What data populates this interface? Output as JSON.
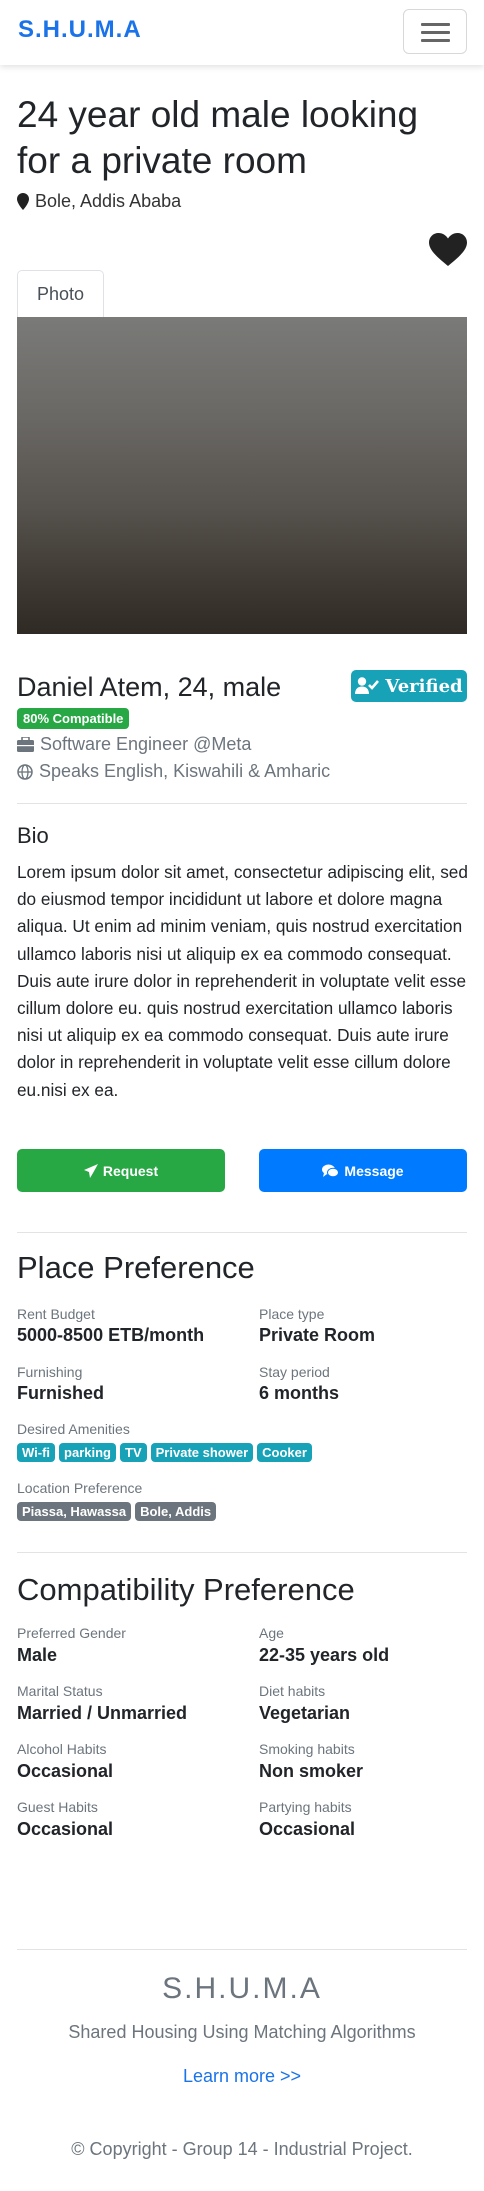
{
  "navbar": {
    "brand": "S.H.U.M.A",
    "menu_icon": "hamburger-menu-icon"
  },
  "listing": {
    "title": "24 year old male looking for a private room",
    "location": "Bole, Addis Ababa",
    "favorite_icon": "heart-icon"
  },
  "tabs": [
    {
      "label": "Photo",
      "active": true
    }
  ],
  "profile": {
    "name": "Daniel Atem, 24, male",
    "verified_label": "Verified",
    "compatibility": "80% Compatible",
    "job": "Software Engineer @Meta",
    "languages": "Speaks English, Kiswahili & Amharic"
  },
  "bio": {
    "heading": "Bio",
    "text": "Lorem ipsum dolor sit amet, consectetur adipiscing elit, sed do eiusmod tempor incididunt ut labore et dolore magna aliqua. Ut enim ad minim veniam, quis nostrud exercitation ullamco laboris nisi ut aliquip ex ea commodo consequat. Duis aute irure dolor in reprehenderit in voluptate velit esse cillum dolore eu. quis nostrud exercitation ullamco laboris nisi ut aliquip ex ea commodo consequat. Duis aute irure dolor in reprehenderit in voluptate velit esse cillum dolore eu.nisi ex ea."
  },
  "actions": {
    "request_label": "Request",
    "message_label": "Message"
  },
  "place_preference": {
    "heading": "Place Preference",
    "rent_budget": {
      "label": "Rent Budget",
      "value": "5000-8500 ETB/month"
    },
    "place_type": {
      "label": "Place type",
      "value": "Private Room"
    },
    "furnishing": {
      "label": "Furnishing",
      "value": "Furnished"
    },
    "stay_period": {
      "label": "Stay period",
      "value": "6 months"
    },
    "amenities_label": "Desired Amenities",
    "amenities": [
      "Wi-fi",
      "parking",
      "TV",
      "Private shower",
      "Cooker"
    ],
    "locations_label": "Location Preference",
    "locations": [
      "Piassa, Hawassa",
      "Bole, Addis"
    ]
  },
  "compatibility_preference": {
    "heading": "Compatibility Preference",
    "gender": {
      "label": "Preferred Gender",
      "value": "Male"
    },
    "age": {
      "label": "Age",
      "value": "22-35 years old"
    },
    "marital": {
      "label": "Marital Status",
      "value": "Married / Unmarried"
    },
    "diet": {
      "label": "Diet habits",
      "value": "Vegetarian"
    },
    "alcohol": {
      "label": "Alcohol Habits",
      "value": "Occasional"
    },
    "smoking": {
      "label": "Smoking habits",
      "value": "Non smoker"
    },
    "guest": {
      "label": "Guest Habits",
      "value": "Occasional"
    },
    "partying": {
      "label": "Partying habits",
      "value": "Occasional"
    }
  },
  "footer": {
    "brand": "S.H.U.M.A",
    "tagline": "Shared Housing Using Matching Algorithms",
    "learn_more": "Learn more >>",
    "copyright": "© Copyright - Group 14 - Industrial Project."
  },
  "colors": {
    "primary": "#007bff",
    "success": "#28a745",
    "info": "#17a2b8",
    "secondary": "#6c757d",
    "brand": "#1a73e8"
  }
}
